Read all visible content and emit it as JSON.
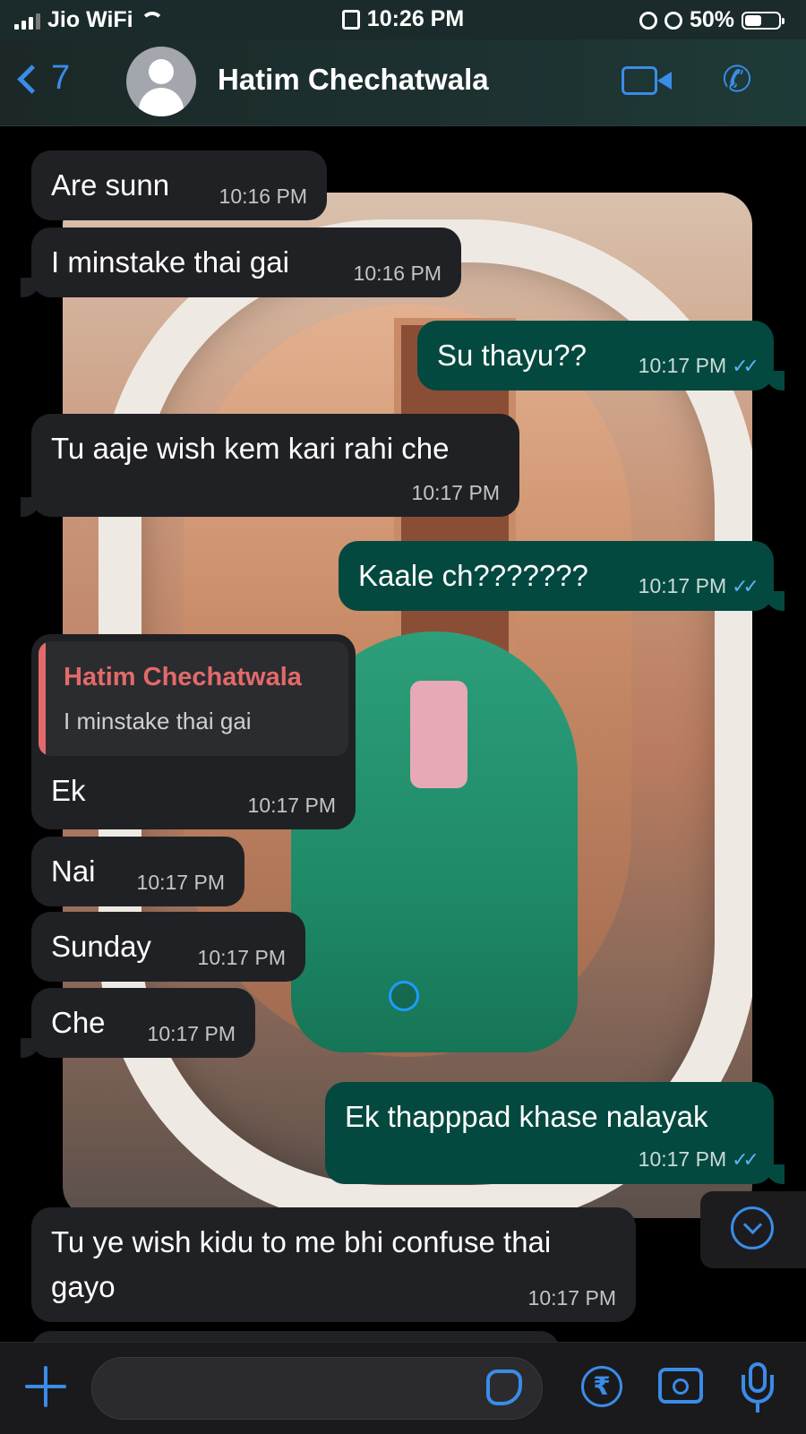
{
  "status_bar": {
    "carrier": "Jio WiFi",
    "time": "10:26 PM",
    "battery_percent": "50%",
    "battery_level": 0.5
  },
  "header": {
    "back_count": "7",
    "contact_name": "Hatim Chechatwala"
  },
  "messages": [
    {
      "direction": "in",
      "text": "Are sunn",
      "time": "10:16 PM"
    },
    {
      "direction": "in",
      "text": "I minstake thai gai",
      "time": "10:16 PM"
    },
    {
      "direction": "out",
      "text": "Su thayu??",
      "time": "10:17 PM",
      "read": true
    },
    {
      "direction": "in",
      "text": "Tu aaje wish kem kari rahi che",
      "time": "10:17 PM"
    },
    {
      "direction": "out",
      "text": "Kaale ch???????",
      "time": "10:17 PM",
      "read": true
    },
    {
      "direction": "in",
      "text": "Ek",
      "time": "10:17 PM",
      "reply_to": {
        "name": "Hatim Chechatwala",
        "text": "I minstake thai gai"
      }
    },
    {
      "direction": "in",
      "text": "Nai",
      "time": "10:17 PM"
    },
    {
      "direction": "in",
      "text": "Sunday",
      "time": "10:17 PM"
    },
    {
      "direction": "in",
      "text": "Che",
      "time": "10:17 PM"
    },
    {
      "direction": "out",
      "text": "Ek thapppad khase nalayak",
      "time": "10:17 PM",
      "read": true
    },
    {
      "direction": "in",
      "text": "Tu ye wish kidu to me bhi confuse thai gayo",
      "time": "10:17 PM"
    }
  ],
  "input_bar": {
    "rupee_symbol": "₹"
  },
  "colors": {
    "accent": "#3a8ce8",
    "incoming_bubble": "#202124",
    "outgoing_bubble": "#04493f",
    "read_ticks": "#5ab4f5",
    "reply_name": "#e36a6a"
  },
  "icons": {
    "read_ticks": "✓✓",
    "phone": "✆"
  }
}
